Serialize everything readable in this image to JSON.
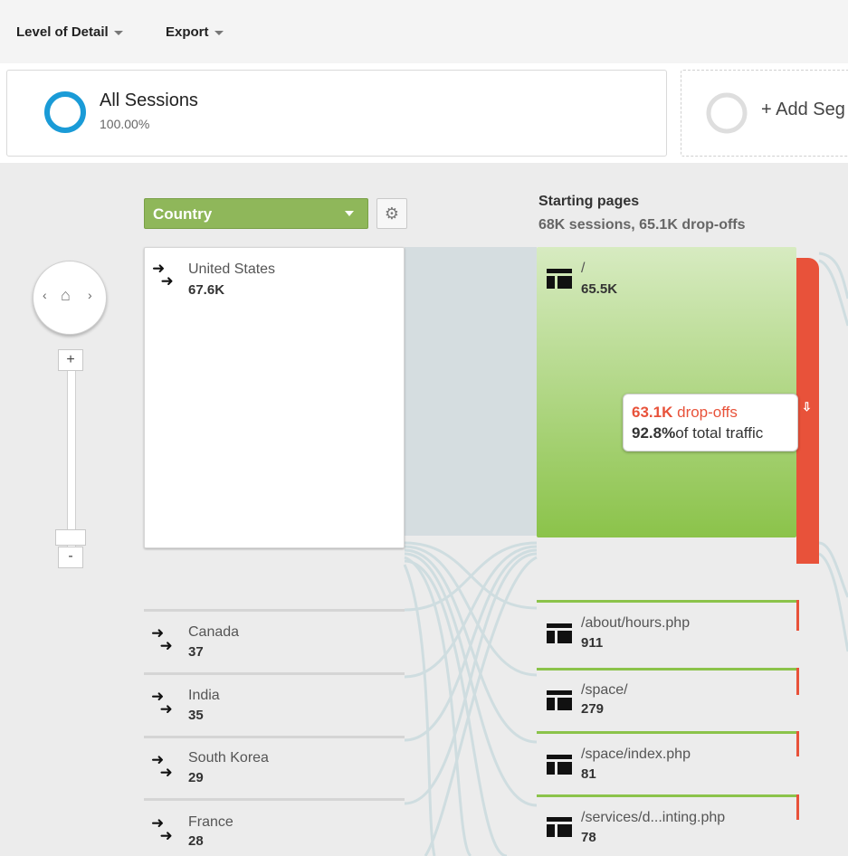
{
  "toolbar": {
    "level_of_detail": "Level of Detail",
    "export": "Export"
  },
  "segments": {
    "all_sessions": {
      "name": "All Sessions",
      "percent": "100.00%"
    },
    "add_segment": "+ Add Seg"
  },
  "dimension": {
    "selected": "Country"
  },
  "starting_pages": {
    "title": "Starting pages",
    "summary": "68K sessions, 65.1K drop-offs"
  },
  "countries": [
    {
      "name": "United States",
      "value": "67.6K"
    },
    {
      "name": "Canada",
      "value": "37"
    },
    {
      "name": "India",
      "value": "35"
    },
    {
      "name": "South Korea",
      "value": "29"
    },
    {
      "name": "France",
      "value": "28"
    }
  ],
  "pages": [
    {
      "name": "/",
      "value": "65.5K"
    },
    {
      "name": "/about/hours.php",
      "value": "911"
    },
    {
      "name": "/space/",
      "value": "279"
    },
    {
      "name": "/space/index.php",
      "value": "81"
    },
    {
      "name": "/services/d...inting.php",
      "value": "78"
    }
  ],
  "tooltip": {
    "dropoffs_value": "63.1K",
    "dropoffs_label": "drop-offs",
    "percent_value": "92.8%",
    "percent_label": "of total traffic"
  },
  "zoom": {
    "plus": "+",
    "minus": "-"
  },
  "colors": {
    "accent_blue": "#1a9bd7",
    "node_green": "#8bc34a",
    "dropoff_red": "#e8523a",
    "dimension_green": "#8fb75a"
  }
}
